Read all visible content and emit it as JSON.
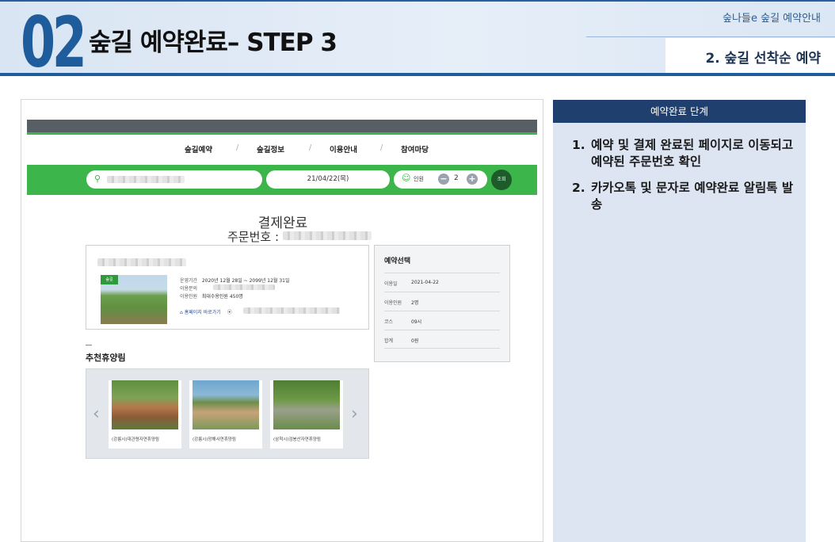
{
  "header": {
    "step_number": "02",
    "title": "숲길 예약완료– STEP 3",
    "top_right_label": "숲나들e 숲길 예약안내",
    "sub_right_label": "2. 숲길 선착순 예약",
    "colors": {
      "accent": "#1f5c9c",
      "band": "#dce7f4"
    }
  },
  "screenshot": {
    "nav": [
      "숲길예약",
      "숲길정보",
      "이용안내",
      "참여마당"
    ],
    "nav_separator": "/",
    "search_bar": {
      "date_value": "21/04/22(목)",
      "people_label": "인원",
      "people_count": "2",
      "minus": "−",
      "plus": "+",
      "search_button": "조회"
    },
    "payment_done_title": "결제완료",
    "order_number_label": "주문번호 : ",
    "product": {
      "badge": "숲길",
      "rows": [
        {
          "label": "운영기간",
          "value": "2020년 12월 28일 ~ 2099년 12월 31일"
        },
        {
          "label": "이용문의",
          "value": ""
        },
        {
          "label": "이용인원",
          "value": "최대수용인원 450명"
        }
      ],
      "homepage_link": "홈페이지 바로가기"
    },
    "reservation_summary": {
      "heading": "예약선택",
      "rows": [
        {
          "label": "이용일",
          "value": "2021-04-22"
        },
        {
          "label": "이용인원",
          "value": "2명"
        },
        {
          "label": "코스",
          "value": "09시"
        },
        {
          "label": "합계",
          "value": "0원"
        }
      ]
    },
    "recommend": {
      "title": "추천휴양림",
      "items": [
        {
          "label": "(강릉시)대관령자연휴양림"
        },
        {
          "label": "(강릉시)망해사연휴양림"
        },
        {
          "label": "(삼척시)검봉산자연휴양림"
        }
      ]
    },
    "colors": {
      "green": "#3cb54a",
      "topbar": "#575e64"
    }
  },
  "panel": {
    "heading": "예약완료 단계",
    "steps": [
      {
        "num": "1.",
        "text": "예약 및 결제 완료된 페이지로 이동되고 예약된 주문번호 확인"
      },
      {
        "num": "2.",
        "text": "카카오톡 및 문자로 예약완료 알림톡 발송"
      }
    ],
    "colors": {
      "head": "#1f3f6e",
      "bg": "#dde5f3"
    }
  }
}
